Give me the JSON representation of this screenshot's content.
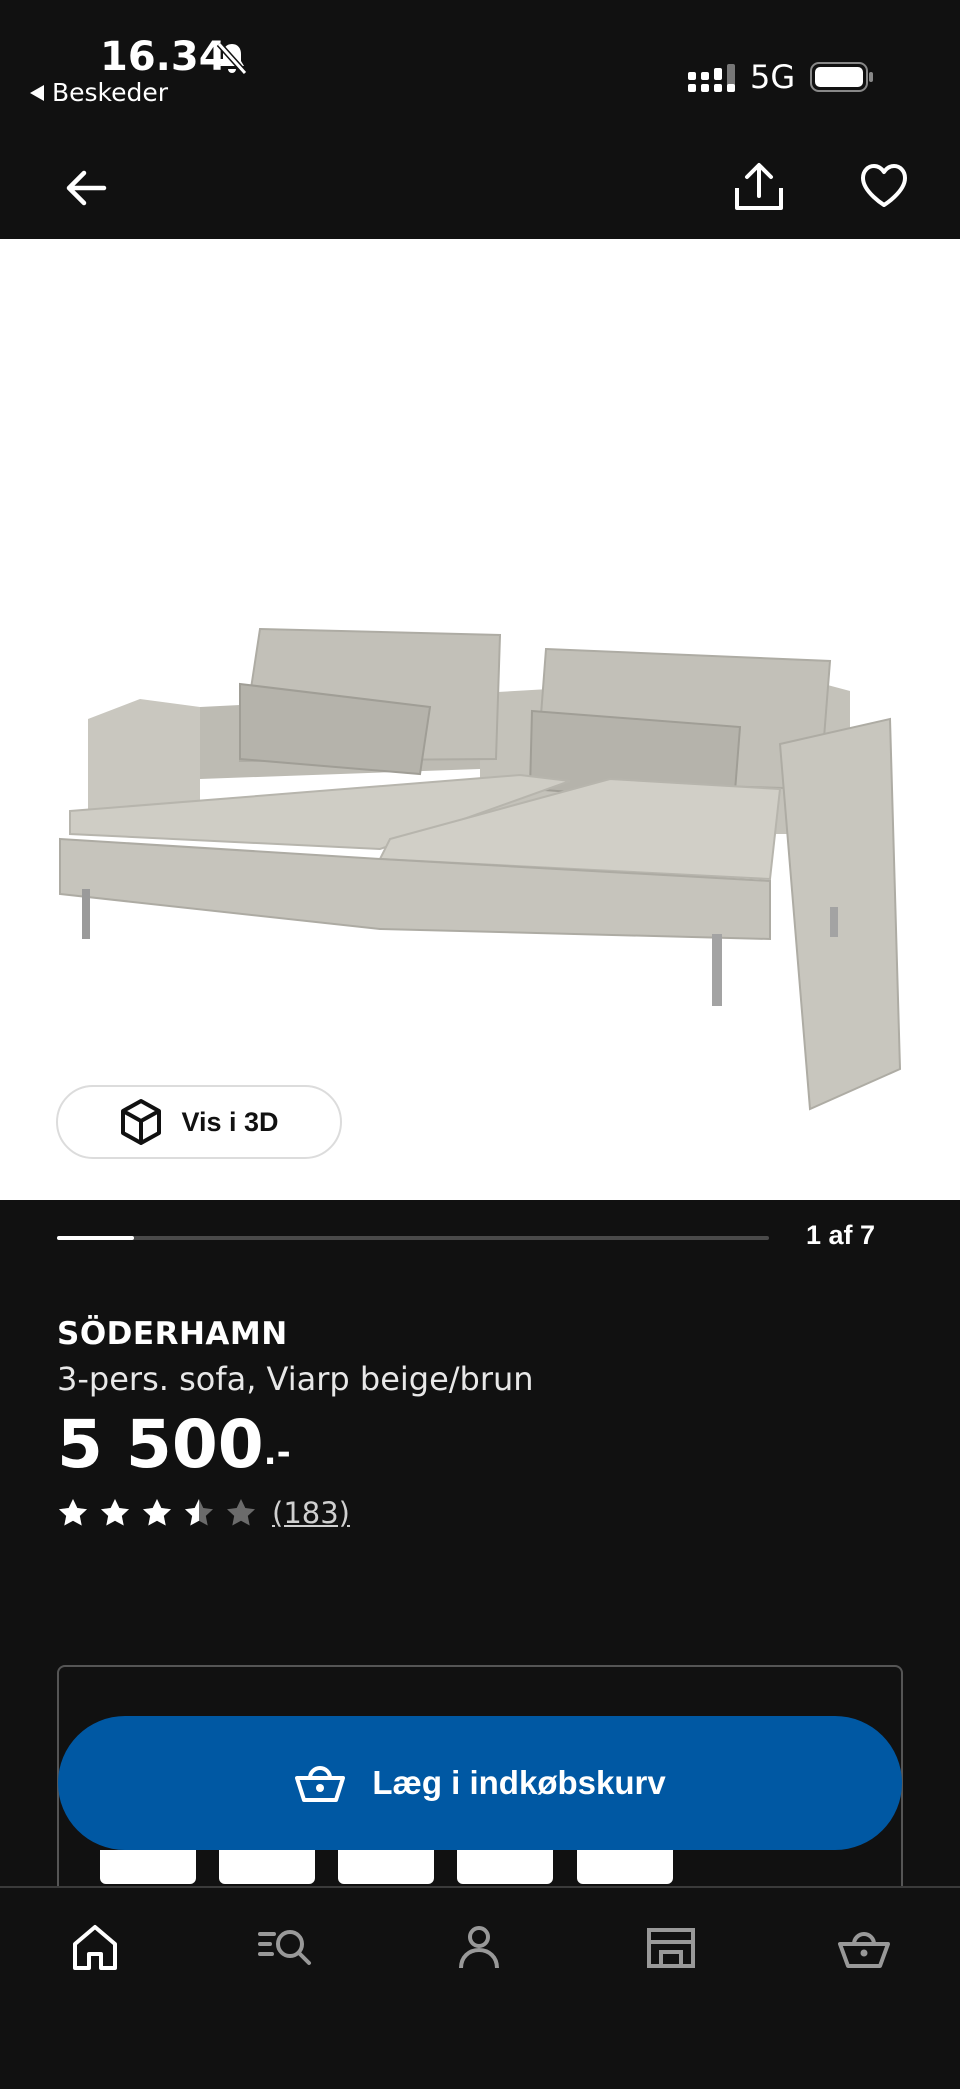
{
  "status_bar": {
    "time": "16.34",
    "back_app_label": "Beskeder",
    "network": "5G"
  },
  "icons": {
    "bell_muted": "bell-slash-icon",
    "back": "arrow-left-icon",
    "share": "share-icon",
    "favorite": "heart-icon",
    "cube": "cube-3d-icon",
    "cart": "basket-icon"
  },
  "hero": {
    "view_3d_label": "Vis i 3D"
  },
  "gallery": {
    "progress_fraction": 0.108,
    "pager_text": "1 af 7"
  },
  "product": {
    "name": "SÖDERHAMN",
    "description": "3-pers. sofa, Viarp beige/brun",
    "price": "5 500",
    "price_suffix": ".-",
    "rating": 3.5,
    "rating_max": 5,
    "review_count": "(183)"
  },
  "purchase": {
    "add_to_cart_label": "Læg i indkøbskurv"
  },
  "tabbar": {
    "items": [
      "home-icon",
      "search-icon",
      "profile-icon",
      "store-icon",
      "basket-icon"
    ]
  },
  "colors": {
    "background": "#111111",
    "accent": "#0058a3"
  }
}
